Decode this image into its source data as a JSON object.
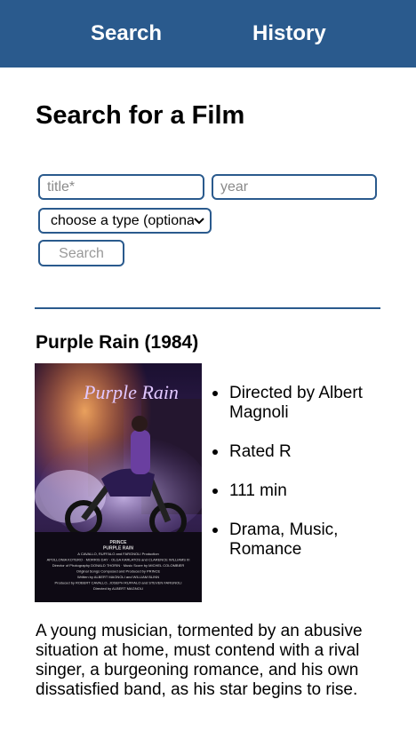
{
  "nav": {
    "search_label": "Search",
    "history_label": "History"
  },
  "page_title": "Search for a Film",
  "form": {
    "title_placeholder": "title*",
    "title_value": "",
    "year_placeholder": "year",
    "year_value": "",
    "type_selected": "choose a type (optional)",
    "search_button": "Search"
  },
  "film": {
    "heading": "Purple Rain (1984)",
    "poster": {
      "title_art": "Purple Rain",
      "credits": [
        "PRINCE",
        "PURPLE RAIN",
        "A CAVALLO, RUFFALO and FARGNOLI Production",
        "APOLLONIA KOTERO · MORRIS DAY · OLGA KARLATOS and CLARENCE WILLIAMS III",
        "Director of Photography DONALD THORIN · Music Score by MICHEL COLOMBIER",
        "Original Songs Composed and Produced by PRINCE",
        "Written by ALBERT MAGNOLI and WILLIAM BLINN",
        "Produced by ROBERT CAVALLO, JOSEPH RUFFALO and STEVEN FARGNOLI",
        "Directed by ALBERT MAGNOLI"
      ]
    },
    "details": [
      "Directed by Albert Magnoli",
      "Rated R",
      "111 min",
      "Drama, Music, Romance"
    ],
    "plot": "A young musician, tormented by an abusive situation at home, must contend with a rival singer, a burgeoning romance, and his own dissatisfied band, as his star begins to rise."
  }
}
